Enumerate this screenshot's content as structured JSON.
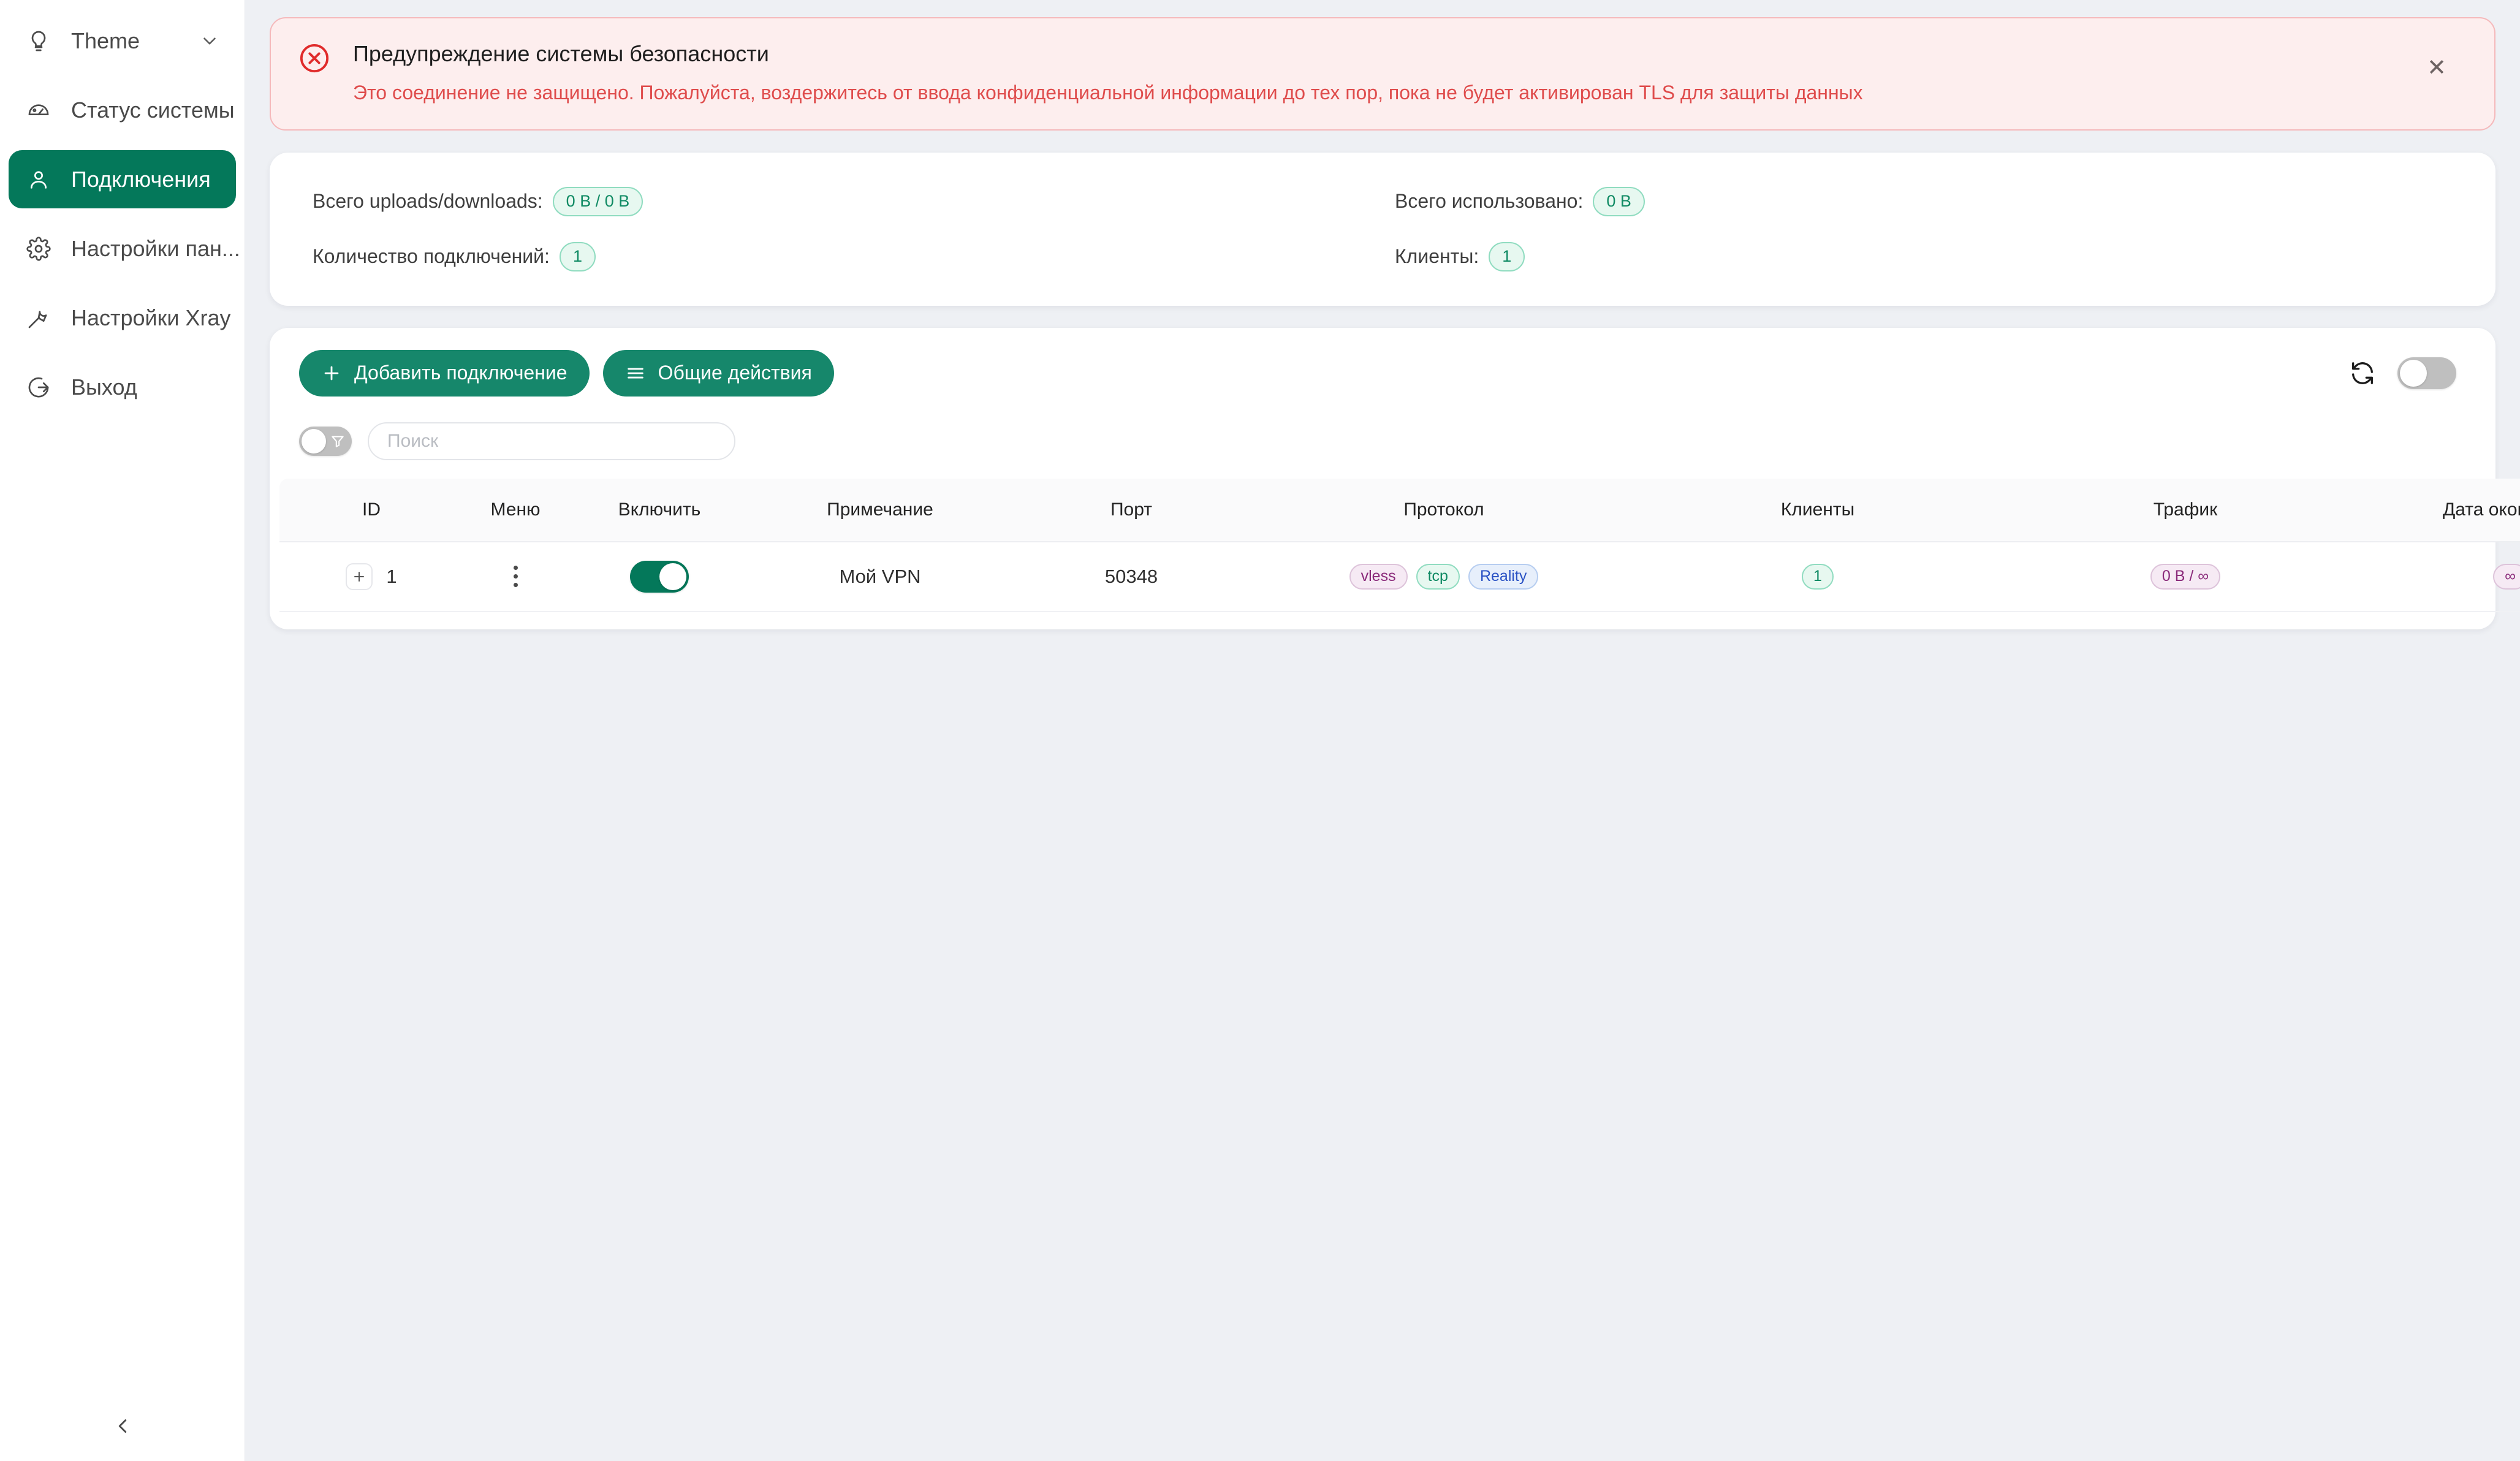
{
  "sidebar": {
    "items": [
      {
        "label": "Theme",
        "icon": "bulb-icon",
        "active": false,
        "chevron": true
      },
      {
        "label": "Статус системы",
        "icon": "gauge-icon",
        "active": false,
        "chevron": false
      },
      {
        "label": "Подключения",
        "icon": "user-icon",
        "active": true,
        "chevron": false
      },
      {
        "label": "Настройки пан...",
        "icon": "gear-icon",
        "active": false,
        "chevron": false
      },
      {
        "label": "Настройки Xray",
        "icon": "wrench-icon",
        "active": false,
        "chevron": false
      },
      {
        "label": "Выход",
        "icon": "logout-icon",
        "active": false,
        "chevron": false
      }
    ],
    "collapse_icon": "chevron-left-icon"
  },
  "alert": {
    "icon": "error-circle-icon",
    "title": "Предупреждение системы безопасности",
    "description": "Это соединение не защищено. Пожалуйста, воздержитесь от ввода конфиденциальной информации до тех пор, пока не будет активирован TLS для защиты данных",
    "close_label": "✕",
    "colors": {
      "bg": "#fdeeee",
      "border": "#f5b9bb",
      "text": "#df4c4c",
      "icon": "#e02b2b"
    }
  },
  "stats": [
    {
      "label": "Всего uploads/downloads:",
      "value": "0 B / 0 B",
      "style": "green"
    },
    {
      "label": "Всего использовано:",
      "value": "0 B",
      "style": "green"
    },
    {
      "label": "Количество подключений:",
      "value": "1",
      "style": "green"
    },
    {
      "label": "Клиенты:",
      "value": "1",
      "style": "green"
    }
  ],
  "toolbar": {
    "add_label": "Добавить подключение",
    "add_icon": "plus-icon",
    "actions_label": "Общие действия",
    "actions_icon": "hamburger-icon",
    "refresh_icon": "refresh-icon",
    "auto_refresh_on": false,
    "accent_color": "#16876b"
  },
  "filter": {
    "toggle_on": false,
    "toggle_icon": "funnel-icon",
    "search_placeholder": "Поиск",
    "search_value": ""
  },
  "table": {
    "columns": [
      "ID",
      "Меню",
      "Включить",
      "Примечание",
      "Порт",
      "Протокол",
      "Клиенты",
      "Трафик",
      "Дата окончания"
    ],
    "rows": [
      {
        "expand_icon": "plus-icon",
        "id": "1",
        "menu_icon": "kebab-menu-icon",
        "enabled": true,
        "note": "Мой VPN",
        "port": "50348",
        "protocol_tags": [
          {
            "text": "vless",
            "style": "purple"
          },
          {
            "text": "tcp",
            "style": "green"
          },
          {
            "text": "Reality",
            "style": "blue"
          }
        ],
        "clients": "1",
        "traffic": "0 B / ∞",
        "expiry": "∞"
      }
    ]
  }
}
